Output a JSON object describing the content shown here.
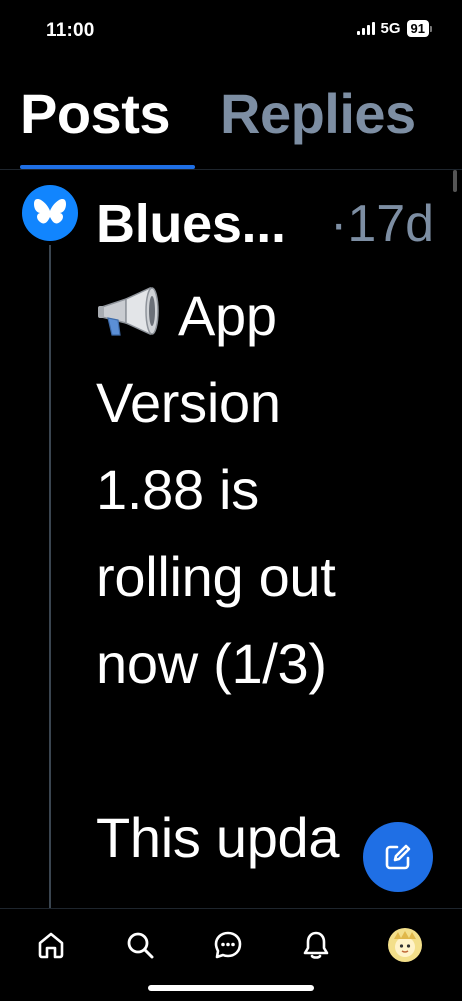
{
  "status_bar": {
    "time": "11:00",
    "network": "5G",
    "battery": "91"
  },
  "tabs": [
    {
      "label": "Posts",
      "active": true
    },
    {
      "label": "Replies",
      "active": false
    }
  ],
  "post": {
    "author": "Blues...",
    "timestamp": "·17d",
    "text": "App\nVersion\n1.88 is\nrolling out\nnow (1/3)\n\nThis upda",
    "leading_icon": "megaphone-icon"
  },
  "bottom_nav": [
    {
      "name": "home",
      "icon": "home-icon"
    },
    {
      "name": "search",
      "icon": "search-icon"
    },
    {
      "name": "chat",
      "icon": "chat-icon"
    },
    {
      "name": "notifications",
      "icon": "bell-icon"
    },
    {
      "name": "profile",
      "icon": "avatar"
    }
  ],
  "colors": {
    "background": "#000000",
    "accent": "#1f6fe5",
    "muted": "#7d8ea3",
    "brand": "#1185fe"
  }
}
